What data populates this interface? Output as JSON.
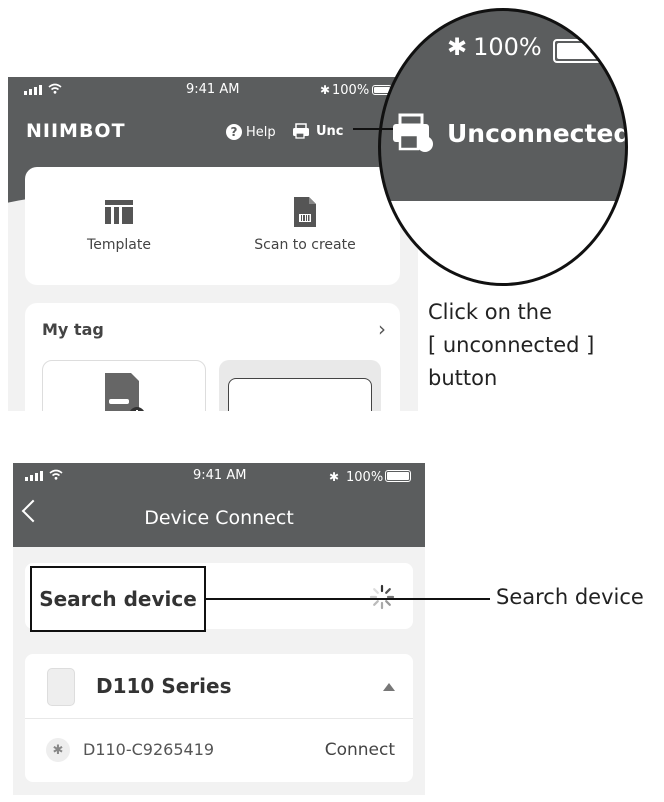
{
  "screen1": {
    "status": {
      "time": "9:41 AM",
      "battery": "100%"
    },
    "brand": "NIIMBOT",
    "help_label": "Help",
    "unconnected_short": "Unc",
    "quick_actions": [
      {
        "label": "Template",
        "icon": "template-icon"
      },
      {
        "label": "Scan to create",
        "icon": "scan-doc-icon"
      }
    ],
    "my_tag": {
      "title": "My tag",
      "arrow": "›"
    },
    "zoom": {
      "battery": "100%",
      "unconnected_label": "Unconnected"
    }
  },
  "caption1": {
    "line1": "Click on the",
    "line2": "[ unconnected ] button"
  },
  "screen2": {
    "status": {
      "time": "9:41 AM",
      "battery": "100%"
    },
    "title": "Device Connect",
    "search_label": "Search device",
    "device_series": "D110 Series",
    "device_name": "D110-C9265419",
    "connect_label": "Connect"
  },
  "caption2": "Search device",
  "colors": {
    "header": "#5b5d5e",
    "background": "#f2f2f2",
    "card": "#ffffff"
  }
}
